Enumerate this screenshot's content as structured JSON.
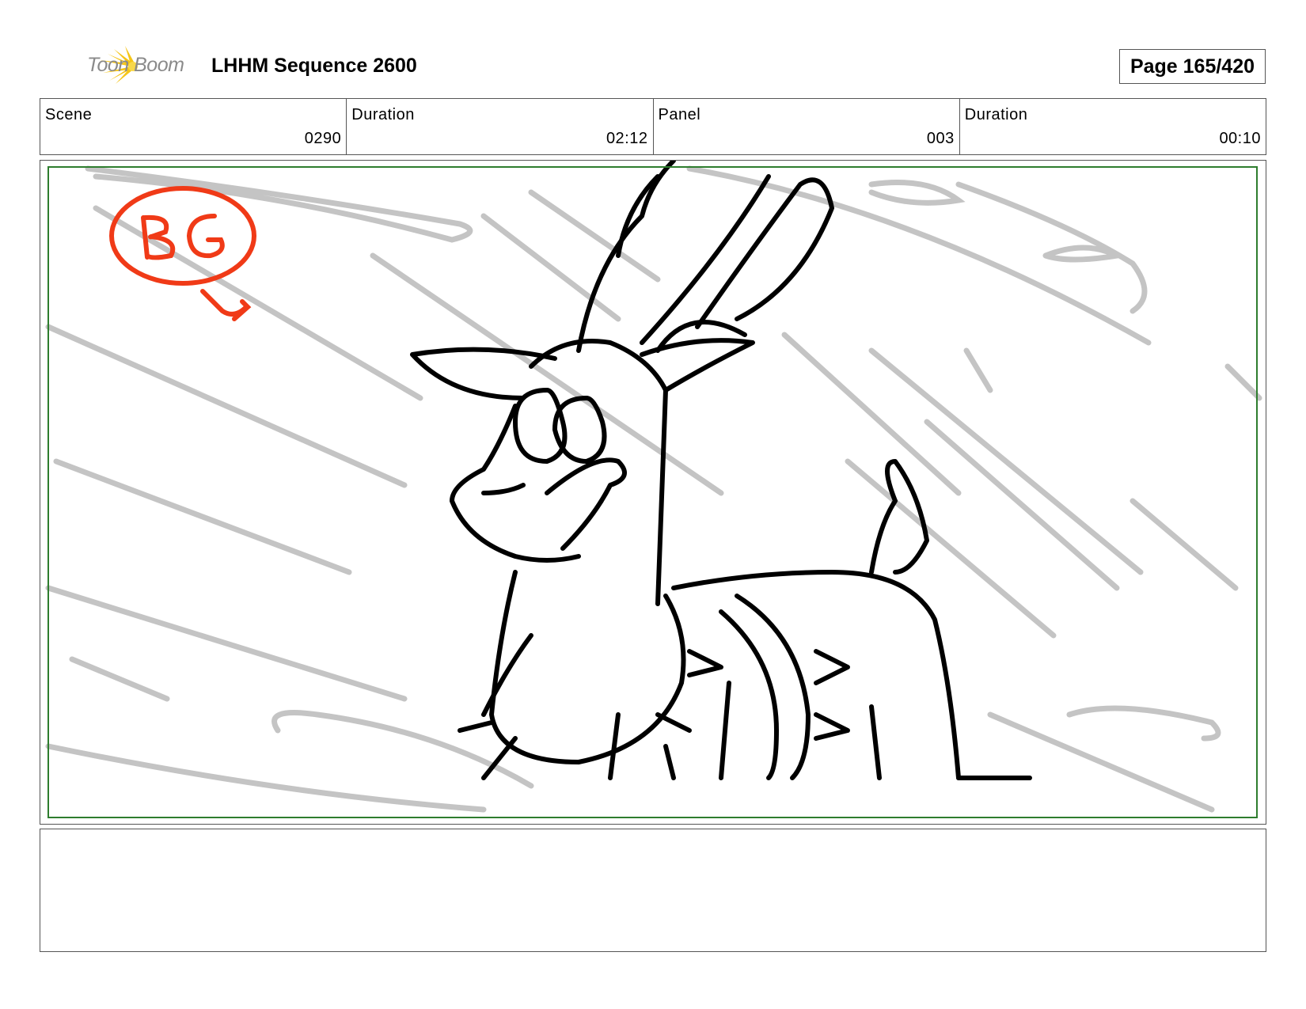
{
  "header": {
    "logo_text": "Toon Boom",
    "title": "LHHM Sequence 2600",
    "page": "Page 165/420"
  },
  "info": [
    {
      "label": "Scene",
      "value": "0290"
    },
    {
      "label": "Duration",
      "value": "02:12"
    },
    {
      "label": "Panel",
      "value": "003"
    },
    {
      "label": "Duration",
      "value": "00:10"
    }
  ],
  "panel": {
    "annotation": "BG",
    "annotation_color": "#f03a17",
    "safe_frame_color": "#2e7d2e"
  },
  "caption": ""
}
